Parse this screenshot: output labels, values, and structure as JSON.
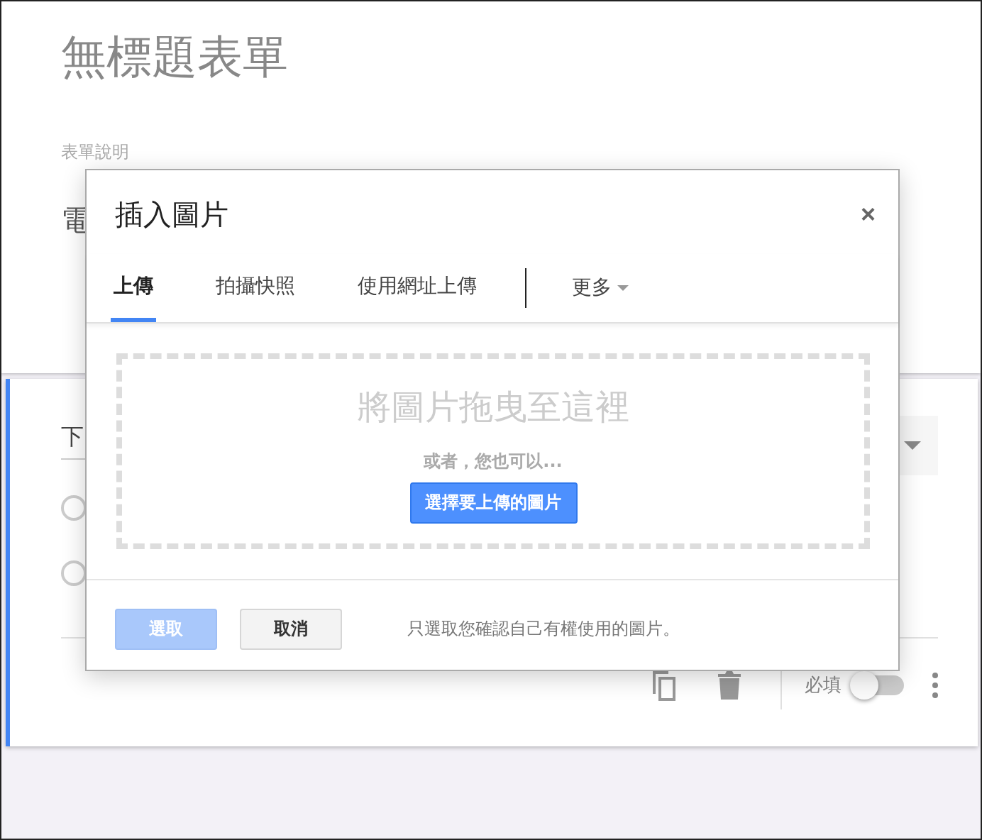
{
  "form": {
    "title": "無標題表單",
    "description": "表單說明",
    "question_fragment": "電"
  },
  "question": {
    "title_fragment": "下",
    "options": [
      {
        "checked": false
      },
      {
        "checked": false
      }
    ],
    "required_label": "必填",
    "required": false
  },
  "dialog": {
    "title": "插入圖片",
    "close": "×",
    "tabs": [
      {
        "label": "上傳",
        "selected": true
      },
      {
        "label": "拍攝快照",
        "selected": false
      },
      {
        "label": "使用網址上傳",
        "selected": false
      }
    ],
    "more": "更多",
    "drop_text": "將圖片拖曳至這裡",
    "or_text": "或者，您也可以...",
    "choose_button": "選擇要上傳的圖片",
    "select_button": {
      "label": "選取",
      "disabled": true
    },
    "cancel_button": "取消",
    "note": "只選取您確認自己有權使用的圖片。"
  }
}
